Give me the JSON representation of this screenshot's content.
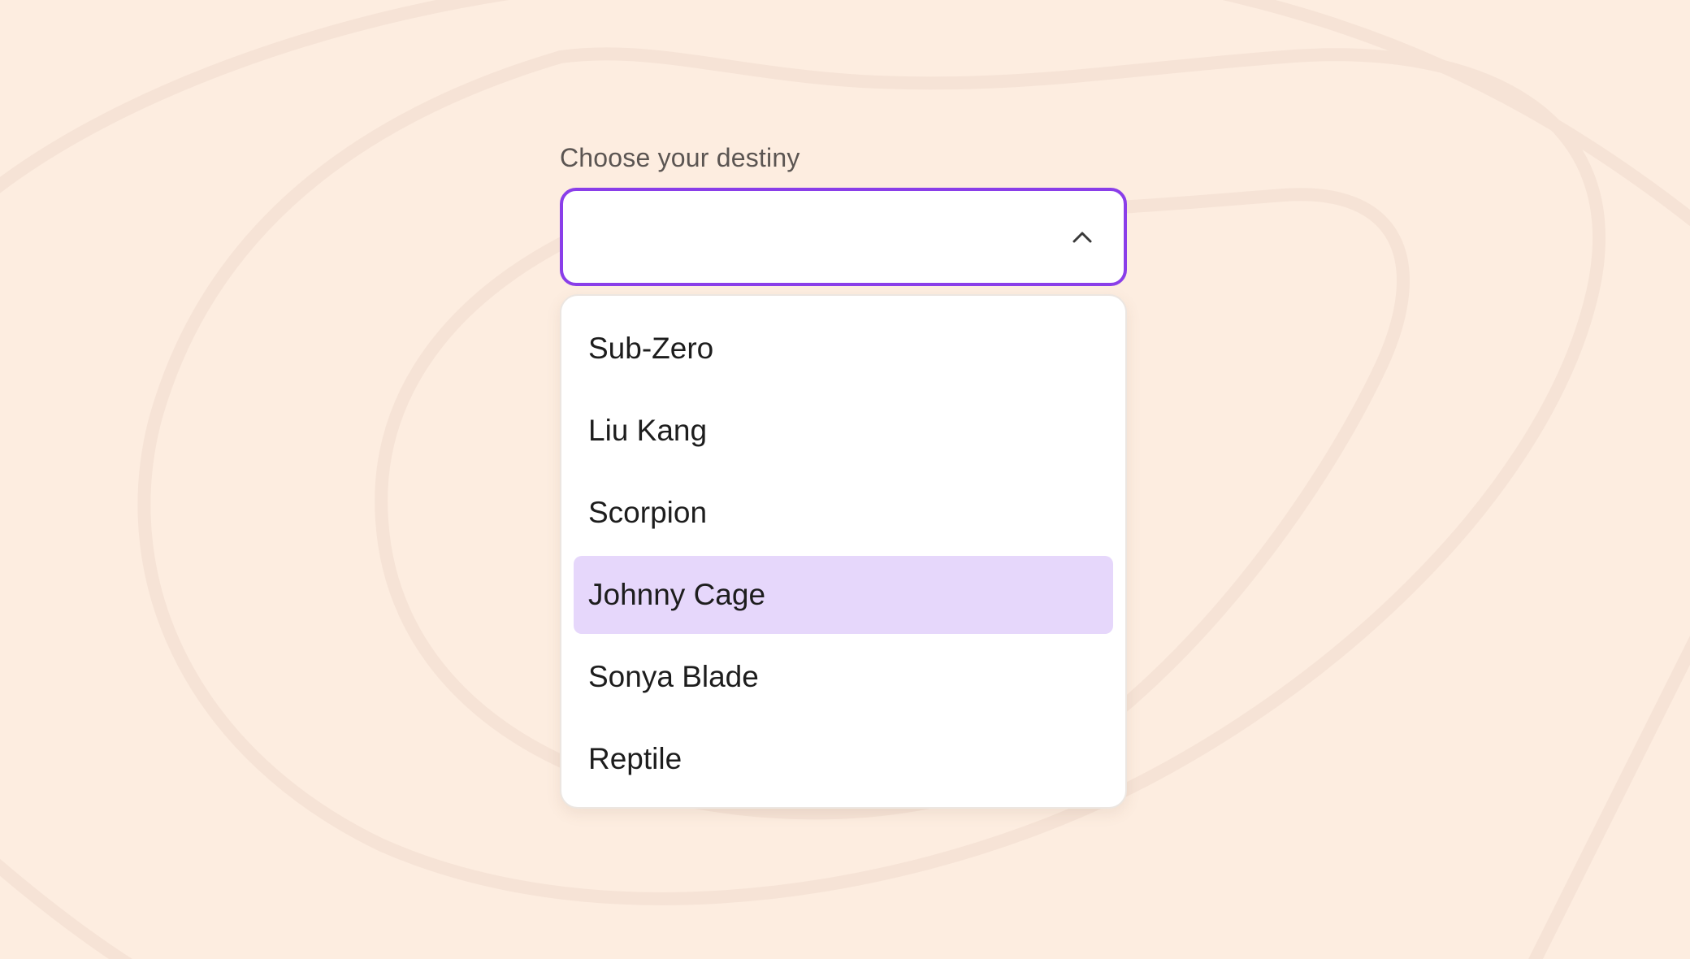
{
  "colors": {
    "page_background": "#fdede0",
    "contour_lines": "#f6e3d6",
    "focus_border": "#8a3ee9",
    "highlight_background": "#e6d7fb"
  },
  "select": {
    "label": "Choose your destiny",
    "value": "",
    "expanded": true,
    "toggle_icon": "chevron-up-icon"
  },
  "options": [
    {
      "label": "Sub-Zero",
      "highlighted": false
    },
    {
      "label": "Liu Kang",
      "highlighted": false
    },
    {
      "label": "Scorpion",
      "highlighted": false
    },
    {
      "label": "Johnny Cage",
      "highlighted": true
    },
    {
      "label": "Sonya Blade",
      "highlighted": false
    },
    {
      "label": "Reptile",
      "highlighted": false
    }
  ]
}
